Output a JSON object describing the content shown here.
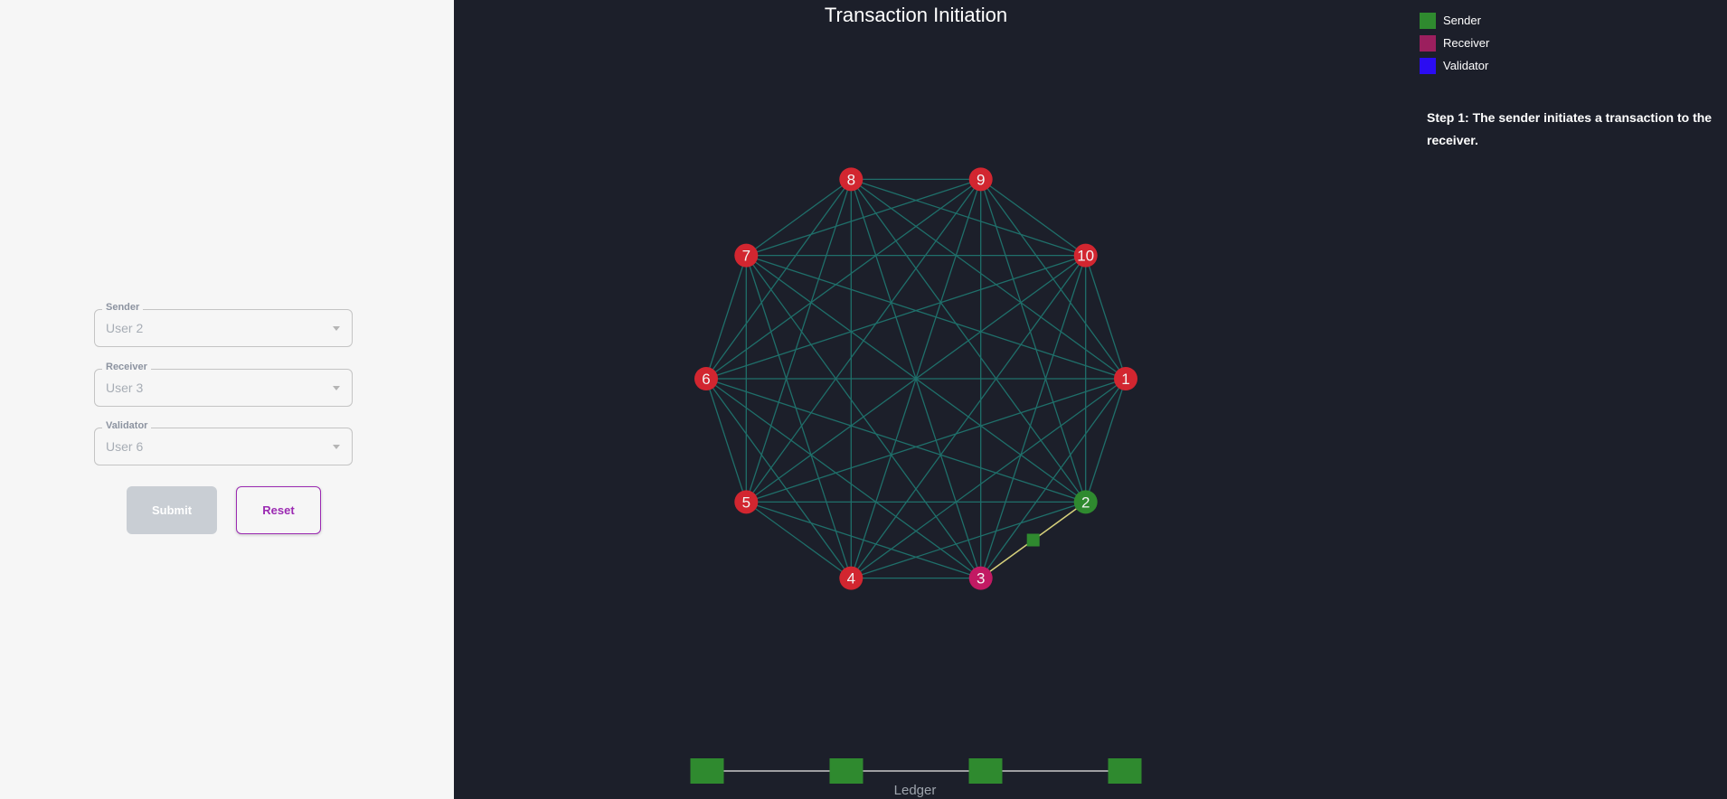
{
  "title": "Transaction Initiation",
  "form": {
    "sender": {
      "label": "Sender",
      "value": "User 2"
    },
    "receiver": {
      "label": "Receiver",
      "value": "User 3"
    },
    "validator": {
      "label": "Validator",
      "value": "User 6"
    },
    "submit_label": "Submit",
    "reset_label": "Reset"
  },
  "legend": [
    {
      "label": "Sender",
      "color": "#2f8a2f"
    },
    {
      "label": "Receiver",
      "color": "#9c1f5e"
    },
    {
      "label": "Validator",
      "color": "#2b0cf2"
    }
  ],
  "step_text": "Step 1: The sender initiates a transaction to the receiver.",
  "graph": {
    "nodes": [
      "1",
      "2",
      "3",
      "4",
      "5",
      "6",
      "7",
      "8",
      "9",
      "10"
    ],
    "sender": "2",
    "receiver": "3",
    "validator": "6",
    "node_color": "#d22630",
    "sender_color": "#2f8a2f",
    "receiver_color": "#c21a63",
    "edge_color": "#1f6f6a",
    "transaction_edge_color": "#d8cf7a",
    "transaction_progress": 0.5
  },
  "ledger": {
    "label": "Ledger",
    "block_count": 4,
    "block_color": "#2f8a2f"
  }
}
